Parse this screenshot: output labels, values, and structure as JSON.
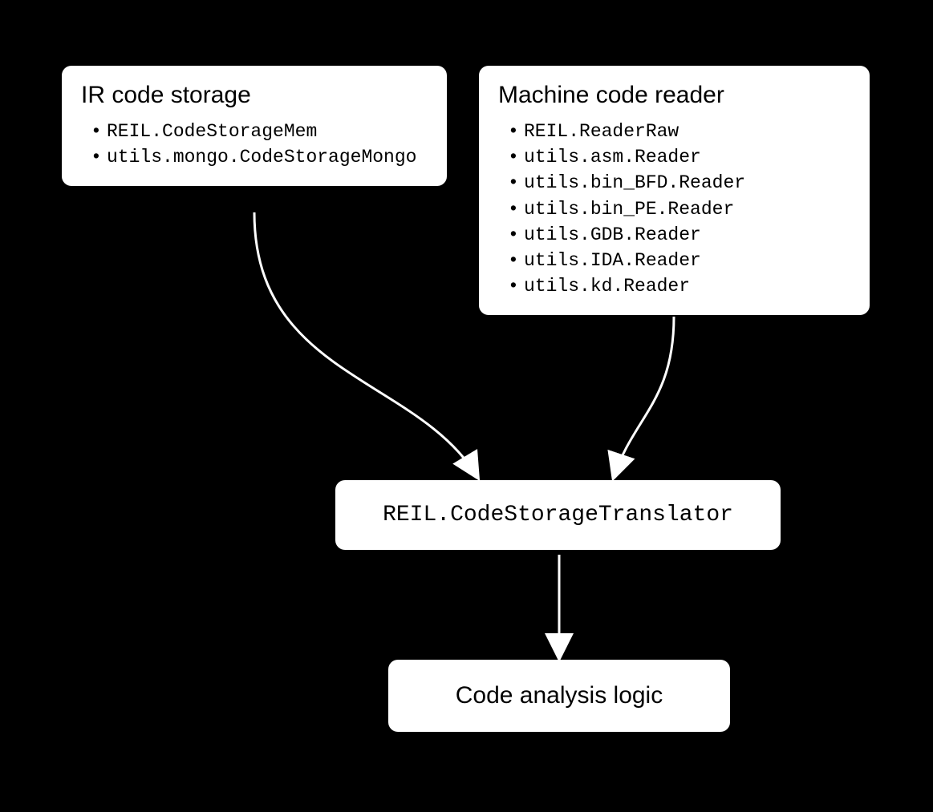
{
  "boxes": {
    "storage": {
      "title": "IR code storage",
      "items": [
        "REIL.CodeStorageMem",
        "utils.mongo.CodeStorageMongo"
      ]
    },
    "reader": {
      "title": "Machine code reader",
      "items": [
        "REIL.ReaderRaw",
        "utils.asm.Reader",
        "utils.bin_BFD.Reader",
        "utils.bin_PE.Reader",
        "utils.GDB.Reader",
        "utils.IDA.Reader",
        "utils.kd.Reader"
      ]
    },
    "translator": {
      "label": "REIL.CodeStorageTranslator"
    },
    "analysis": {
      "label": "Code analysis logic"
    }
  },
  "arrows": [
    {
      "from": "storage",
      "to": "translator"
    },
    {
      "from": "reader",
      "to": "translator"
    },
    {
      "from": "translator",
      "to": "analysis"
    }
  ]
}
